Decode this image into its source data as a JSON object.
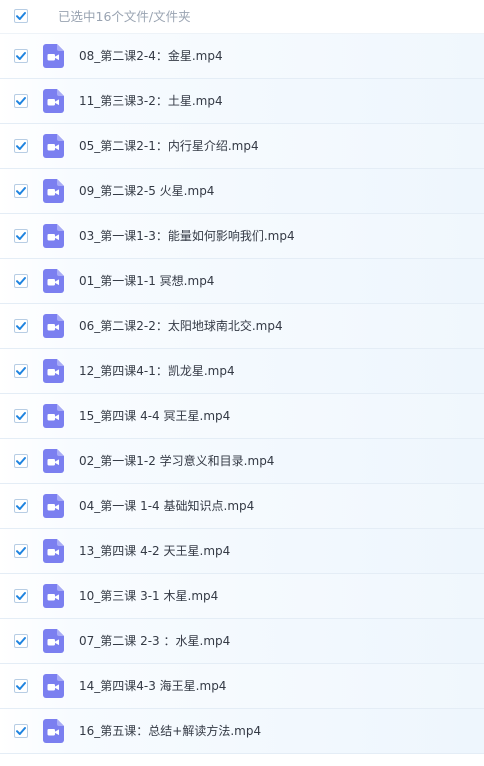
{
  "header": {
    "selection_text": "已选中16个文件/文件夹",
    "checked": true
  },
  "files": [
    {
      "name": "08_第二课2-4：金星.mp4",
      "checked": true,
      "icon": "video-file-icon"
    },
    {
      "name": "11_第三课3-2：土星.mp4",
      "checked": true,
      "icon": "video-file-icon"
    },
    {
      "name": "05_第二课2-1：内行星介绍.mp4",
      "checked": true,
      "icon": "video-file-icon"
    },
    {
      "name": "09_第二课2-5 火星.mp4",
      "checked": true,
      "icon": "video-file-icon"
    },
    {
      "name": "03_第一课1-3：能量如何影响我们.mp4",
      "checked": true,
      "icon": "video-file-icon"
    },
    {
      "name": "01_第一课1-1 冥想.mp4",
      "checked": true,
      "icon": "video-file-icon"
    },
    {
      "name": "06_第二课2-2：太阳地球南北交.mp4",
      "checked": true,
      "icon": "video-file-icon"
    },
    {
      "name": "12_第四课4-1：凯龙星.mp4",
      "checked": true,
      "icon": "video-file-icon"
    },
    {
      "name": "15_第四课 4-4 冥王星.mp4",
      "checked": true,
      "icon": "video-file-icon"
    },
    {
      "name": "02_第一课1-2 学习意义和目录.mp4",
      "checked": true,
      "icon": "video-file-icon"
    },
    {
      "name": "04_第一课 1-4 基础知识点.mp4",
      "checked": true,
      "icon": "video-file-icon"
    },
    {
      "name": "13_第四课 4-2 天王星.mp4",
      "checked": true,
      "icon": "video-file-icon"
    },
    {
      "name": "10_第三课 3-1 木星.mp4",
      "checked": true,
      "icon": "video-file-icon"
    },
    {
      "name": "07_第二课 2-3 ：水星.mp4",
      "checked": true,
      "icon": "video-file-icon"
    },
    {
      "name": "14_第四课4-3 海王星.mp4",
      "checked": true,
      "icon": "video-file-icon"
    },
    {
      "name": "16_第五课：总结+解读方法.mp4",
      "checked": true,
      "icon": "video-file-icon"
    }
  ],
  "colors": {
    "checkmark": "#1f84e0",
    "video_icon": "#7b7ff0",
    "text": "#343a45",
    "header_text": "#9aa4b2"
  }
}
